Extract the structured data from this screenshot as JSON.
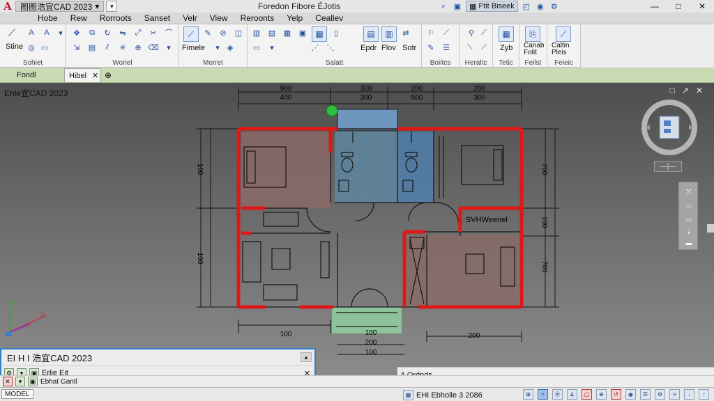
{
  "titlebar": {
    "logo": "A",
    "app_tab": "图图浩宜CAD 2023",
    "app_tab_caret": "▾",
    "center_title": "Foredon  Fibore ÉJotis",
    "share_label": "Ftit Biseek",
    "window_controls": [
      "—",
      "□",
      "✕"
    ]
  },
  "menu": [
    "Hobe",
    "Rew",
    "Rorroots",
    "Sanset",
    "Velr",
    "View",
    "Reroonts",
    "Yelp",
    "Ceallev"
  ],
  "ribbon": {
    "panels": [
      {
        "label": "Sohiet"
      },
      {
        "label": "Woriel"
      },
      {
        "label": "Morret"
      },
      {
        "label": "Salatt"
      },
      {
        "label": "Boiitcs"
      },
      {
        "label": "Heraltc"
      },
      {
        "label": "Tetic"
      },
      {
        "label": "Feilst"
      },
      {
        "label": "Feieic"
      }
    ],
    "texts": {
      "stine": "Stine",
      "fimele": "Fimele",
      "epdr": "Epdr",
      "flov": "Flov",
      "sotr": "Sotr",
      "zyb": "Zyb",
      "carab": "Canab\nFolit",
      "caltin": "Caltin\nPleis"
    }
  },
  "doctabs": {
    "first": "Fondl",
    "active": "Hibel",
    "active_close": "✕",
    "plus": "⊕"
  },
  "canvas": {
    "viewport_label": "Ehle宜CAD 2023",
    "viewport_ctrl": [
      "□",
      "↗",
      "✕"
    ],
    "wcs": "—|—",
    "dims": {
      "top_row_1": [
        "900",
        "300",
        "200",
        "200"
      ],
      "top_row_2": [
        "400",
        "300",
        "500",
        "300"
      ],
      "left": [
        "100",
        "100"
      ],
      "right": [
        "700",
        "100",
        "700"
      ],
      "bottom": [
        "100",
        "100",
        "200",
        "100",
        "200"
      ],
      "annot": "SVHWeenel"
    }
  },
  "cmd": {
    "title": "EI H I  浩宜CAD  2023",
    "row1_label": "Erlie  Eit",
    "row2_label": "Ebhat Gantl",
    "close": "✕",
    "expand": "▴"
  },
  "strip": {
    "label": "A Ordnds"
  },
  "status": {
    "model": "MODEL",
    "coord": "EHI Ebholle 3 2086",
    "icons": [
      "⊞",
      "⌗",
      "⦿",
      "∡",
      "▢",
      "⊕",
      "↺",
      "◉",
      "☰",
      "⚙",
      "≡",
      "↓",
      "↑"
    ]
  },
  "colors": {
    "wall": "#e01717",
    "line": "#151515",
    "bed_fill": "#8a6a66",
    "bath_fill": "#5f86a8",
    "balcony_fill": "#8fcfa0",
    "accent": "#2f7fc9"
  }
}
